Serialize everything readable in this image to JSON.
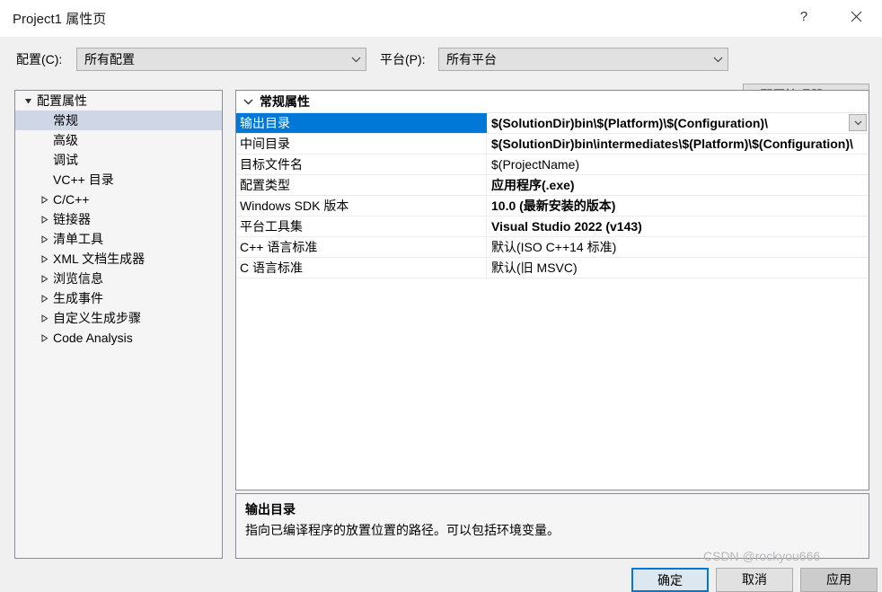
{
  "window": {
    "title": "Project1 属性页",
    "help_tooltip": "?",
    "close_tooltip": "✕"
  },
  "toolbar": {
    "config_label": "配置(C):",
    "config_value": "所有配置",
    "platform_label": "平台(P):",
    "platform_value": "所有平台",
    "config_manager_button": "配置管理器(O)..."
  },
  "tree": {
    "items": [
      {
        "label": "配置属性",
        "indent": 0,
        "expander": "expanded",
        "selected": false
      },
      {
        "label": "常规",
        "indent": 1,
        "expander": "none",
        "selected": true
      },
      {
        "label": "高级",
        "indent": 1,
        "expander": "none",
        "selected": false
      },
      {
        "label": "调试",
        "indent": 1,
        "expander": "none",
        "selected": false
      },
      {
        "label": "VC++ 目录",
        "indent": 1,
        "expander": "none",
        "selected": false
      },
      {
        "label": "C/C++",
        "indent": 1,
        "expander": "collapsed",
        "selected": false
      },
      {
        "label": "链接器",
        "indent": 1,
        "expander": "collapsed",
        "selected": false
      },
      {
        "label": "清单工具",
        "indent": 1,
        "expander": "collapsed",
        "selected": false
      },
      {
        "label": "XML 文档生成器",
        "indent": 1,
        "expander": "collapsed",
        "selected": false
      },
      {
        "label": "浏览信息",
        "indent": 1,
        "expander": "collapsed",
        "selected": false
      },
      {
        "label": "生成事件",
        "indent": 1,
        "expander": "collapsed",
        "selected": false
      },
      {
        "label": "自定义生成步骤",
        "indent": 1,
        "expander": "collapsed",
        "selected": false
      },
      {
        "label": "Code Analysis",
        "indent": 1,
        "expander": "collapsed",
        "selected": false
      }
    ]
  },
  "grid": {
    "group_title": "常规属性",
    "rows": [
      {
        "name": "输出目录",
        "value": "$(SolutionDir)bin\\$(Platform)\\$(Configuration)\\",
        "bold": true,
        "selected": true,
        "dropdown": true
      },
      {
        "name": "中间目录",
        "value": "$(SolutionDir)bin\\intermediates\\$(Platform)\\$(Configuration)\\",
        "bold": true,
        "selected": false,
        "dropdown": false
      },
      {
        "name": "目标文件名",
        "value": "$(ProjectName)",
        "bold": false,
        "selected": false,
        "dropdown": false
      },
      {
        "name": "配置类型",
        "value": "应用程序(.exe)",
        "bold": true,
        "selected": false,
        "dropdown": false
      },
      {
        "name": "Windows SDK 版本",
        "value": "10.0 (最新安装的版本)",
        "bold": true,
        "selected": false,
        "dropdown": false
      },
      {
        "name": "平台工具集",
        "value": "Visual Studio 2022 (v143)",
        "bold": true,
        "selected": false,
        "dropdown": false
      },
      {
        "name": "C++ 语言标准",
        "value": "默认(ISO C++14 标准)",
        "bold": false,
        "selected": false,
        "dropdown": false
      },
      {
        "name": "C 语言标准",
        "value": "默认(旧 MSVC)",
        "bold": false,
        "selected": false,
        "dropdown": false
      }
    ]
  },
  "description": {
    "title": "输出目录",
    "body": "指向已编译程序的放置位置的路径。可以包括环境变量。"
  },
  "footer": {
    "ok_label": "确定",
    "cancel_label": "取消",
    "apply_label": "应用"
  },
  "watermark": "CSDN @rockyou666",
  "colors": {
    "selection": "#0078d7",
    "tree_selection": "#cfd6e6",
    "dialog_bg": "#f0f0f0",
    "panel_border": "#8a8a99"
  }
}
